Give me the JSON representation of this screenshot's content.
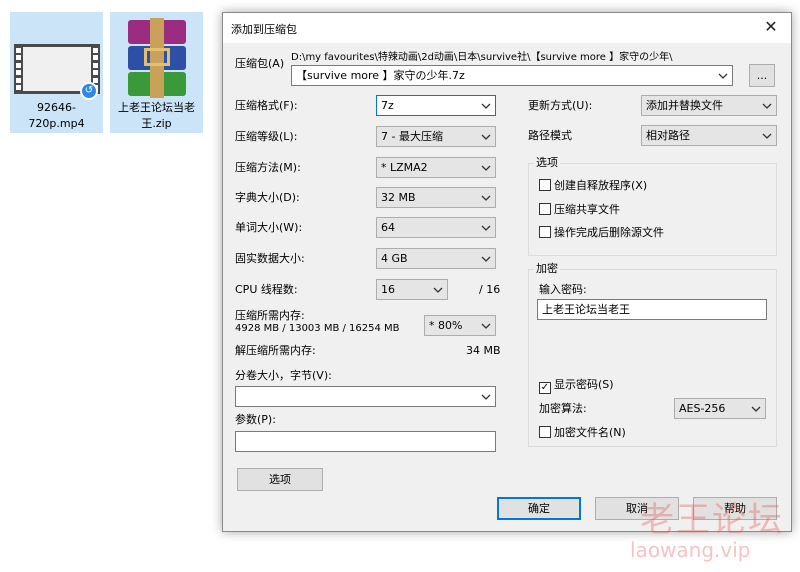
{
  "desktop": {
    "file1": {
      "label": "92646-720p.mp4",
      "icon": "video-file-icon"
    },
    "file2": {
      "label": "上老王论坛当老王.zip",
      "icon": "winrar-archive-icon"
    }
  },
  "dialog": {
    "title": "添加到压缩包",
    "close": "✕",
    "archive_label": "压缩包(A)",
    "archive_path": "D:\\my favourites\\特辣动画\\2d动画\\日本\\survive社\\【survive more 】家守の少年\\",
    "archive_name": "【survive more 】家守の少年.7z",
    "browse_label": "...",
    "left": {
      "format_label": "压缩格式(F):",
      "format_value": "7z",
      "level_label": "压缩等级(L):",
      "level_value": "7 - 最大压缩",
      "method_label": "压缩方法(M):",
      "method_value": "* LZMA2",
      "dict_label": "字典大小(D):",
      "dict_value": "32 MB",
      "word_label": "单词大小(W):",
      "word_value": "64",
      "solid_label": "固实数据大小:",
      "solid_value": "4 GB",
      "cpu_label": "CPU 线程数:",
      "cpu_value": "16",
      "cpu_total": "/ 16",
      "mem_comp_label": "压缩所需内存:",
      "mem_comp_value": "4928 MB / 13003 MB / 16254 MB",
      "mem_percent": "* 80%",
      "mem_decomp_label": "解压缩所需内存:",
      "mem_decomp_value": "34 MB",
      "split_label": "分卷大小，字节(V):",
      "split_value": "",
      "params_label": "参数(P):",
      "params_value": "",
      "options_button": "选项"
    },
    "right": {
      "update_label": "更新方式(U):",
      "update_value": "添加并替换文件",
      "path_label": "路径模式",
      "path_value": "相对路径",
      "options_group": "选项",
      "opt_sfx": "创建自释放程序(X)",
      "opt_shared": "压缩共享文件",
      "opt_delete": "操作完成后删除源文件",
      "encrypt_group": "加密",
      "password_label": "输入密码:",
      "password_value": "上老王论坛当老王",
      "show_password": "显示密码(S)",
      "algo_label": "加密算法:",
      "algo_value": "AES-256",
      "encrypt_names": "加密文件名(N)"
    },
    "buttons": {
      "ok": "确定",
      "cancel": "取消",
      "help": "帮助"
    }
  },
  "watermark": {
    "text": "老王论坛",
    "url": "laowang.vip"
  }
}
